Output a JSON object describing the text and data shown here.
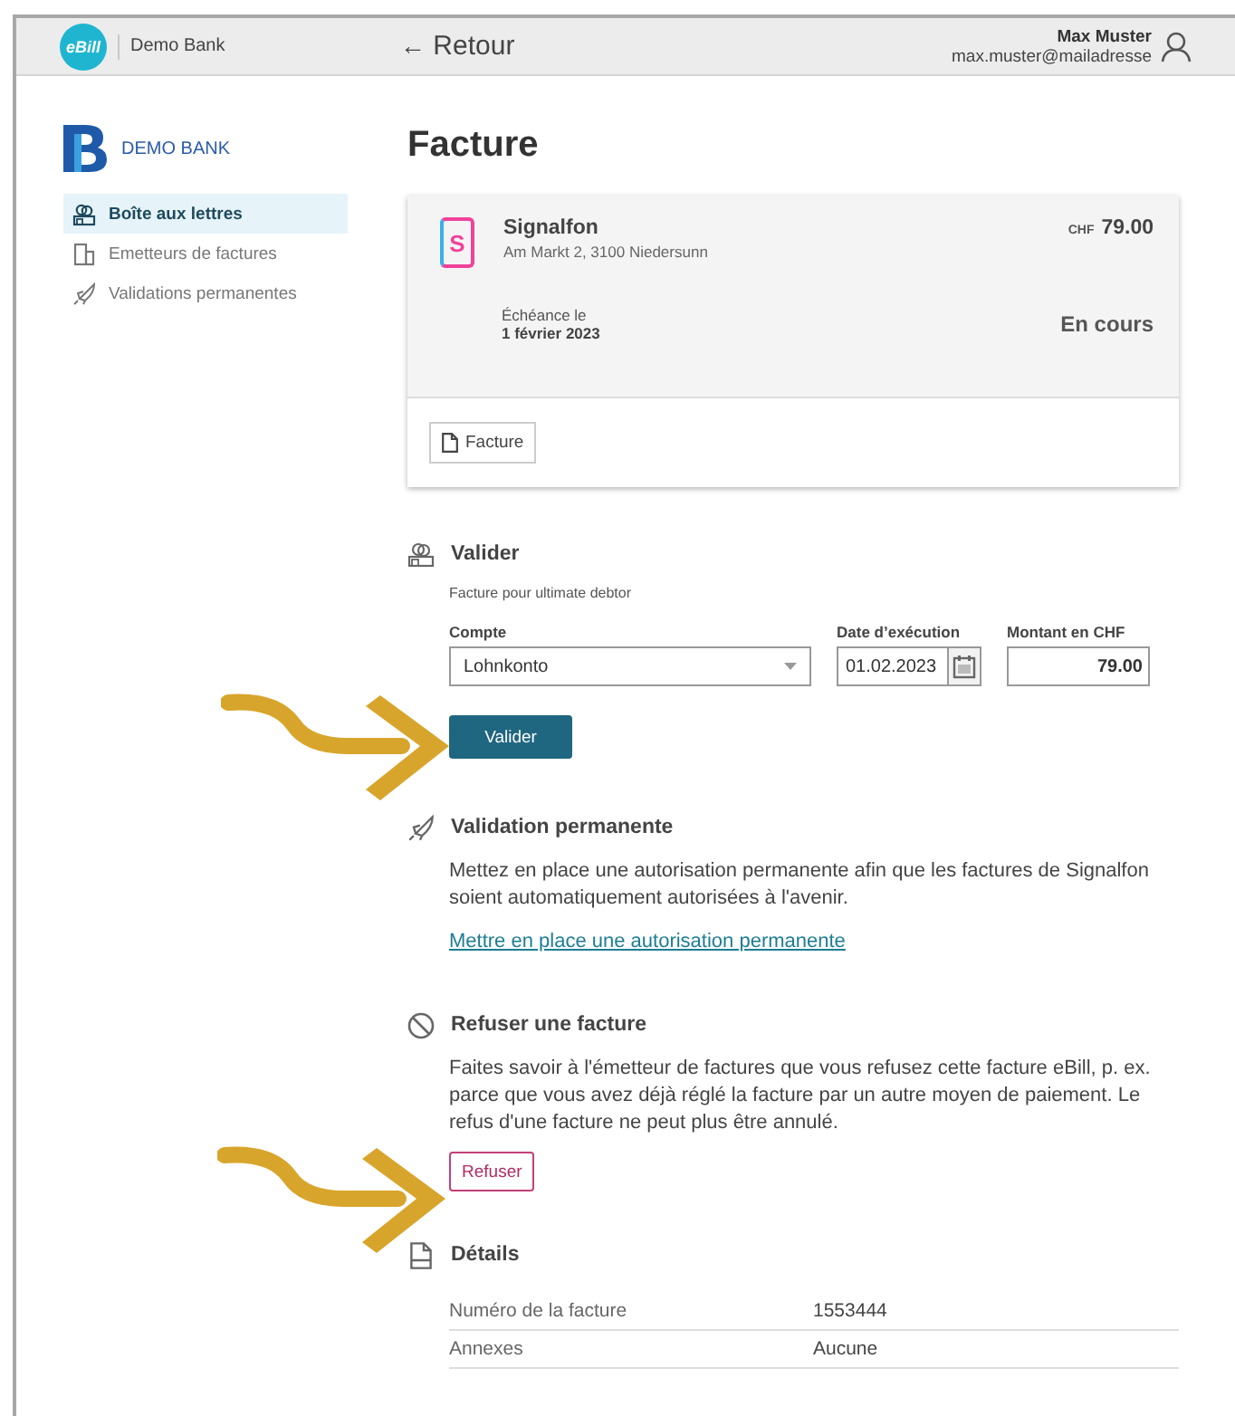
{
  "header": {
    "logo": "eBill",
    "bank": "Demo Bank",
    "back_icon": "←",
    "back": "Retour",
    "user_name": "Max Muster",
    "user_email": "max.muster@mailadresse"
  },
  "sidebar": {
    "brand": "DEMO BANK",
    "items": [
      {
        "label": "Boîte aux lettres",
        "selected": true
      },
      {
        "label": "Emetteurs de factures",
        "selected": false
      },
      {
        "label": "Validations permanentes",
        "selected": false
      }
    ]
  },
  "title": "Facture",
  "invoice": {
    "logo_letter": "S",
    "biller": "Signalfon",
    "address": "Am Markt 2, 3100 Niedersunn",
    "currency": "CHF",
    "amount": "79.00",
    "due_label": "Échéance le",
    "due_date": "1 février 2023",
    "status": "En cours",
    "document_button": "Facture"
  },
  "validate": {
    "title": "Valider",
    "subtitle": "Facture pour ultimate debtor",
    "fields": [
      {
        "kind": "select",
        "label": "Compte",
        "value": "Lohnkonto"
      },
      {
        "kind": "date",
        "label": "Date d’exécution",
        "value": "01.02.2023"
      },
      {
        "kind": "amount",
        "label": "Montant en CHF",
        "value": "79.00"
      }
    ],
    "button": "Valider"
  },
  "permanent": {
    "title": "Validation permanente",
    "text": "Mettez en place une autorisation permanente afin que les factures de Signalfon soient automatiquement autorisées à l'avenir.",
    "link": "Mettre en place une autorisation permanente"
  },
  "refuse": {
    "title": "Refuser une facture",
    "text": "Faites savoir à l'émetteur de factures que vous refusez cette facture eBill, p. ex. parce que vous avez déjà réglé la facture par un autre moyen de paiement. Le refus d'une facture ne peut plus être annulé.",
    "button": "Refuser"
  },
  "details": {
    "title": "Détails",
    "rows": [
      {
        "label": "Numéro de la facture",
        "value": "1553444"
      },
      {
        "label": "Annexes",
        "value": "Aucune"
      }
    ]
  }
}
